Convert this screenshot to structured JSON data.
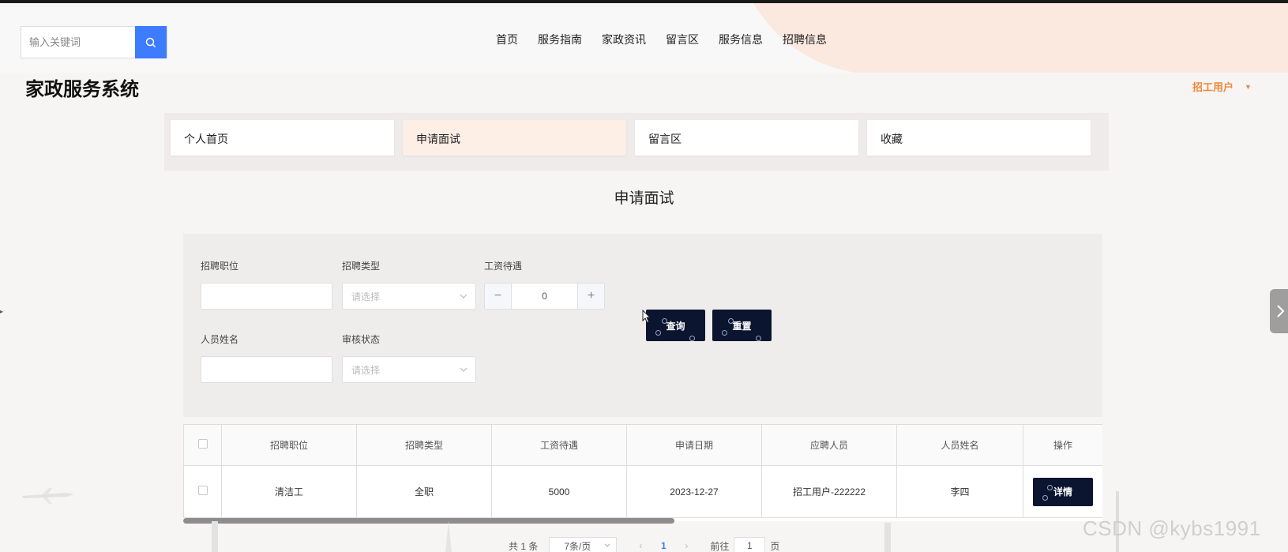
{
  "search": {
    "placeholder": "输入关键词"
  },
  "nav": {
    "items": [
      "首页",
      "服务指南",
      "家政资讯",
      "留言区",
      "服务信息",
      "招聘信息"
    ]
  },
  "site_title": "家政服务系统",
  "user_menu": {
    "label": "招工用户"
  },
  "tabs": [
    {
      "label": "个人首页",
      "active": false
    },
    {
      "label": "申请面试",
      "active": true
    },
    {
      "label": "留言区",
      "active": false
    },
    {
      "label": "收藏",
      "active": false
    }
  ],
  "page_heading": "申请面试",
  "filters": {
    "position_label": "招聘职位",
    "position_value": "",
    "type_label": "招聘类型",
    "type_placeholder": "请选择",
    "salary_label": "工资待遇",
    "salary_value": "0",
    "name_label": "人员姓名",
    "name_value": "",
    "status_label": "审核状态",
    "status_placeholder": "请选择",
    "query_button": "查询",
    "reset_button": "重置"
  },
  "table": {
    "headers": [
      "招聘职位",
      "招聘类型",
      "工资待遇",
      "申请日期",
      "应聘人员",
      "人员姓名",
      "操作"
    ],
    "rows": [
      {
        "position": "清洁工",
        "type": "全职",
        "salary": "5000",
        "date": "2023-12-27",
        "applicant": "招工用户-222222",
        "name": "李四",
        "action": "详情"
      }
    ]
  },
  "pagination": {
    "total": "共 1 条",
    "page_size": "7条/页",
    "current_page": "1",
    "goto_prefix": "前往",
    "goto_value": "1",
    "goto_suffix": "页"
  },
  "watermark": "CSDN @kybs1991",
  "colors": {
    "accent_blue": "#3d7bff",
    "accent_orange": "#f0883a",
    "dark_button": "#0b1530",
    "active_tab": "#fdeee6"
  }
}
